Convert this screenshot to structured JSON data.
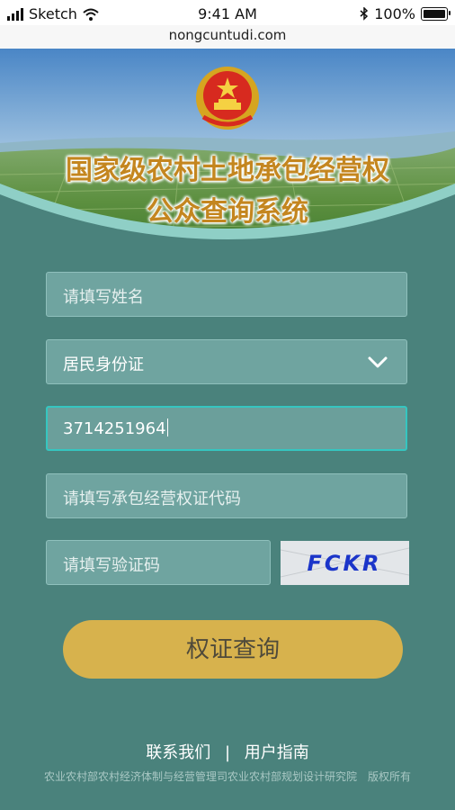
{
  "status_bar": {
    "carrier": "Sketch",
    "time": "9:41 AM",
    "battery": "100%"
  },
  "browser": {
    "url": "nongcuntudi.com"
  },
  "header": {
    "title_line1": "国家级农村土地承包经营权",
    "title_line2": "公众查询系统"
  },
  "form": {
    "name_placeholder": "请填写姓名",
    "id_type_value": "居民身份证",
    "id_number_value": "3714251964",
    "cert_code_placeholder": "请填写承包经营权证代码",
    "captcha_placeholder": "请填写验证码",
    "captcha_text": "FCKR",
    "submit_label": "权证查询"
  },
  "footer": {
    "contact_label": "联系我们",
    "separator": "|",
    "guide_label": "用户指南",
    "copyright": "农业农村部农村经济体制与经营管理司农业农村部规划设计研究院　版权所有"
  },
  "colors": {
    "background": "#4a827c",
    "field_fill": "#6fa4a0",
    "active_border": "#35c6c0",
    "button": "#d7b24d",
    "title": "#c4861f"
  }
}
